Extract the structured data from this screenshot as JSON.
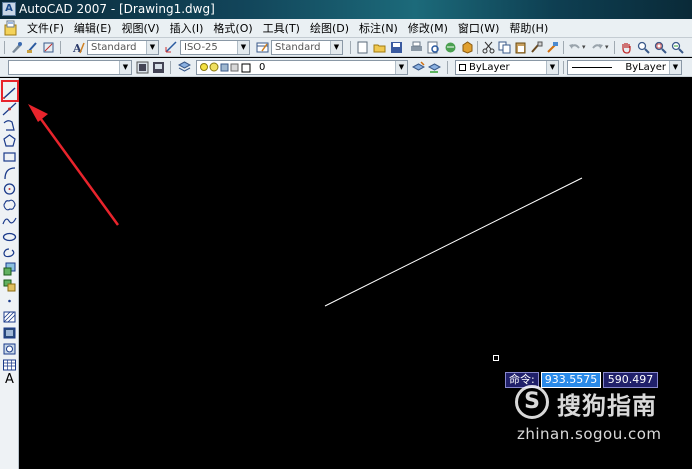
{
  "window": {
    "title": "AutoCAD 2007 - [Drawing1.dwg]",
    "app_icon_glyph": "A"
  },
  "menu": {
    "items": [
      {
        "label": "文件(F)"
      },
      {
        "label": "编辑(E)"
      },
      {
        "label": "视图(V)"
      },
      {
        "label": "插入(I)"
      },
      {
        "label": "格式(O)"
      },
      {
        "label": "工具(T)"
      },
      {
        "label": "绘图(D)"
      },
      {
        "label": "标注(N)"
      },
      {
        "label": "修改(M)"
      },
      {
        "label": "窗口(W)"
      },
      {
        "label": "帮助(H)"
      }
    ]
  },
  "styles_toolbar": {
    "text_style": "Standard",
    "dim_style": "ISO-25",
    "table_style": "Standard"
  },
  "layers_toolbar": {
    "layer_name": "0",
    "color": "ByLayer",
    "linetype": "ByLayer"
  },
  "draw_tools": [
    {
      "name": "line-tool-icon"
    },
    {
      "name": "construction-line-icon"
    },
    {
      "name": "polyline-icon"
    },
    {
      "name": "polygon-icon"
    },
    {
      "name": "rectangle-icon"
    },
    {
      "name": "arc-icon"
    },
    {
      "name": "circle-icon"
    },
    {
      "name": "revision-cloud-icon"
    },
    {
      "name": "spline-icon"
    },
    {
      "name": "ellipse-icon"
    },
    {
      "name": "ellipse-arc-icon"
    },
    {
      "name": "insert-block-icon"
    },
    {
      "name": "make-block-icon"
    },
    {
      "name": "point-icon"
    },
    {
      "name": "hatch-icon"
    },
    {
      "name": "gradient-icon"
    },
    {
      "name": "region-icon"
    },
    {
      "name": "table-icon"
    },
    {
      "name": "multiline-text-icon"
    }
  ],
  "multiline_text_glyph": "A",
  "dynamic_input": {
    "prompt": "命令:",
    "x_value": "933.5575",
    "y_value": "590.497"
  },
  "watermark": {
    "logo_glyph": "S",
    "name": "搜狗指南",
    "url": "zhinan.sogou.com"
  },
  "colors": {
    "canvas": "#000000",
    "highlight": "#e8242c",
    "dyn_input_active": "#2a8ae8",
    "dyn_input_bg": "#20206a"
  }
}
